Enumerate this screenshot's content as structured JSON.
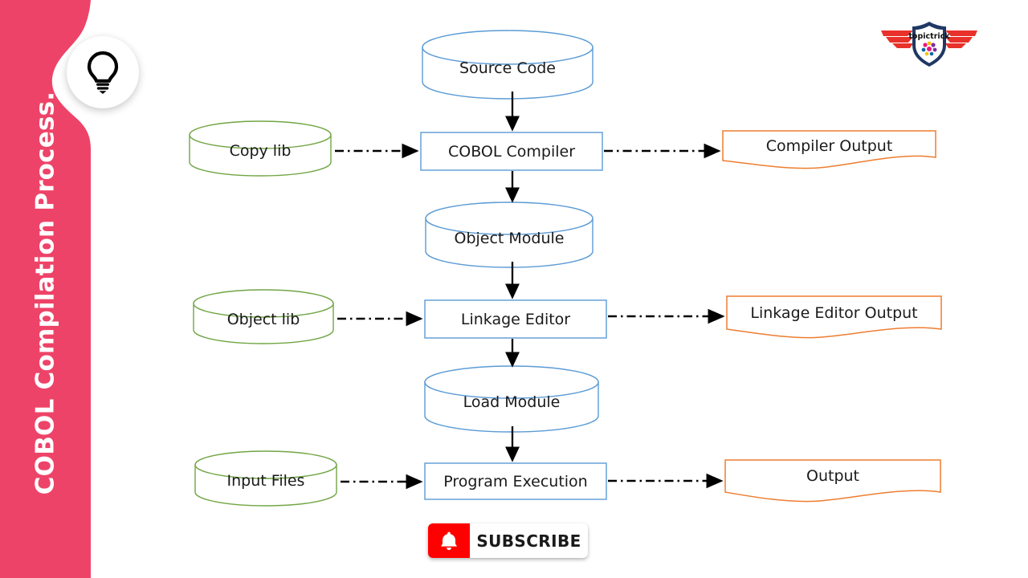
{
  "sidebar": {
    "title": "COBOL Compilation Process.",
    "band_color": "#ee4368",
    "badge_icon": "lightbulb-icon"
  },
  "brand": {
    "name": "topictrick",
    "shield_color": "#1f3864",
    "wing_color": "#e8312a"
  },
  "diagram": {
    "type": "flowchart",
    "title": "COBOL Compilation Process",
    "colors": {
      "cylinder_blue": "#5b9bd5",
      "cylinder_green": "#71a544",
      "process_blue": "#5b9bd5",
      "document_orange": "#ed7d31",
      "arrow_black": "#000000"
    },
    "nodes": [
      {
        "id": "source-code",
        "label": "Source Code",
        "shape": "cylinder",
        "column": "center",
        "stroke": "blue"
      },
      {
        "id": "cobol-compiler",
        "label": "COBOL Compiler",
        "shape": "process",
        "column": "center",
        "stroke": "blue"
      },
      {
        "id": "object-module",
        "label": "Object Module",
        "shape": "cylinder",
        "column": "center",
        "stroke": "blue"
      },
      {
        "id": "linkage-editor",
        "label": "Linkage Editor",
        "shape": "process",
        "column": "center",
        "stroke": "blue"
      },
      {
        "id": "load-module",
        "label": "Load Module",
        "shape": "cylinder",
        "column": "center",
        "stroke": "blue"
      },
      {
        "id": "program-execution",
        "label": "Program Execution",
        "shape": "process",
        "column": "center",
        "stroke": "blue"
      },
      {
        "id": "copy-lib",
        "label": "Copy lib",
        "shape": "cylinder",
        "column": "left",
        "stroke": "green"
      },
      {
        "id": "object-lib",
        "label": "Object lib",
        "shape": "cylinder",
        "column": "left",
        "stroke": "green"
      },
      {
        "id": "input-files",
        "label": "Input Files",
        "shape": "cylinder",
        "column": "left",
        "stroke": "green"
      },
      {
        "id": "compiler-output",
        "label": "Compiler Output",
        "shape": "document",
        "column": "right",
        "stroke": "orange"
      },
      {
        "id": "linkage-output",
        "label": "Linkage Editor Output",
        "shape": "document",
        "column": "right",
        "stroke": "orange"
      },
      {
        "id": "output",
        "label": "Output",
        "shape": "document",
        "column": "right",
        "stroke": "orange"
      }
    ],
    "edges": [
      {
        "from": "source-code",
        "to": "cobol-compiler",
        "style": "solid"
      },
      {
        "from": "cobol-compiler",
        "to": "object-module",
        "style": "solid"
      },
      {
        "from": "object-module",
        "to": "linkage-editor",
        "style": "solid"
      },
      {
        "from": "linkage-editor",
        "to": "load-module",
        "style": "solid"
      },
      {
        "from": "load-module",
        "to": "program-execution",
        "style": "solid"
      },
      {
        "from": "copy-lib",
        "to": "cobol-compiler",
        "style": "dash-dot"
      },
      {
        "from": "object-lib",
        "to": "linkage-editor",
        "style": "dash-dot"
      },
      {
        "from": "input-files",
        "to": "program-execution",
        "style": "dash-dot"
      },
      {
        "from": "cobol-compiler",
        "to": "compiler-output",
        "style": "dash-dot"
      },
      {
        "from": "linkage-editor",
        "to": "linkage-output",
        "style": "dash-dot"
      },
      {
        "from": "program-execution",
        "to": "output",
        "style": "dash-dot"
      }
    ]
  },
  "subscribe": {
    "label": "SUBSCRIBE",
    "icon": "bell-icon",
    "button_color": "#ff0000"
  }
}
